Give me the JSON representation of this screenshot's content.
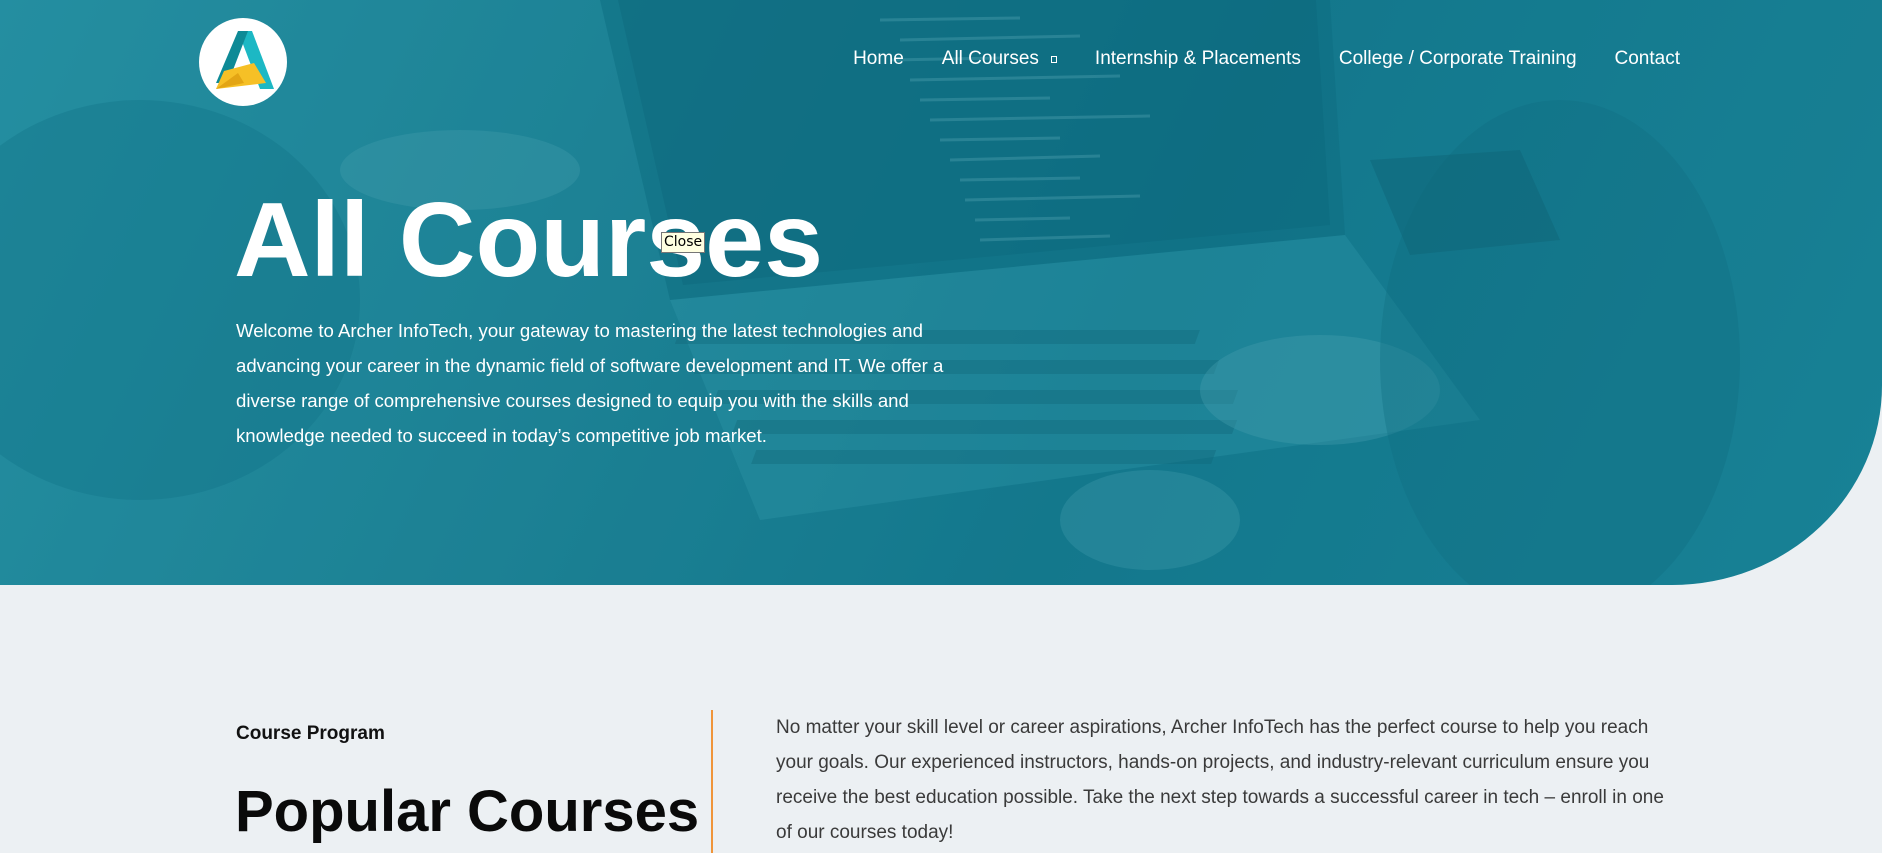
{
  "brand": {
    "logo_icon": "archer-a-logo",
    "accent": "#f0953a",
    "teal": "#1b8598"
  },
  "nav": {
    "items": [
      {
        "label": "Home"
      },
      {
        "label": "All Courses",
        "has_dropdown": true
      },
      {
        "label": "Internship & Placements"
      },
      {
        "label": "College / Corporate Training"
      },
      {
        "label": "Contact"
      }
    ]
  },
  "hero": {
    "title": "All Courses",
    "tooltip": "Close",
    "description": "Welcome to Archer InfoTech, your gateway to mastering the latest technologies and advancing your career in the dynamic field of software development and IT. We offer a diverse range of comprehensive courses designed to equip you with the skills and knowledge needed to succeed in today’s competitive job market."
  },
  "section": {
    "kicker": "Course Program",
    "title": "Popular Courses",
    "description": "No matter your skill level or career aspirations, Archer InfoTech has the perfect course to help you reach your goals. Our experienced instructors, hands-on projects, and industry-relevant curriculum ensure you receive the best education possible. Take the next step towards a successful career in tech – enroll in one of our courses today!"
  }
}
